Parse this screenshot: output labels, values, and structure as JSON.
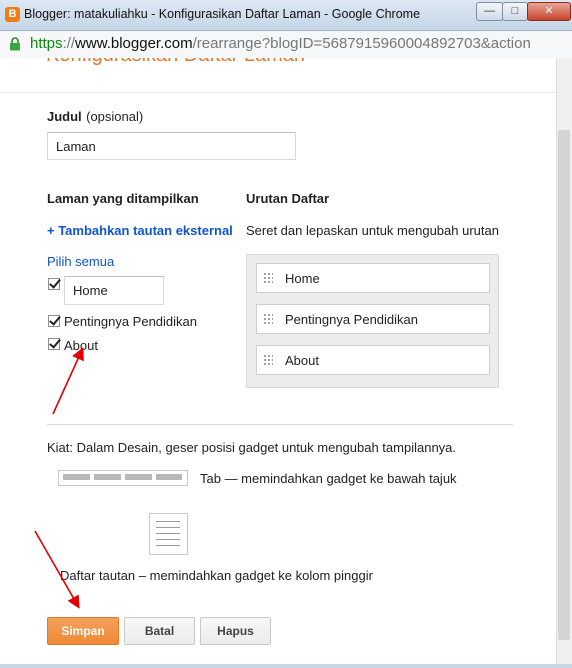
{
  "window": {
    "title": "Blogger: matakuliahku - Konfigurasikan Daftar Laman - Google Chrome",
    "favicon_letter": "B",
    "minimize": "—",
    "maximize": "□",
    "close": "✕"
  },
  "address": {
    "scheme": "https",
    "separator": "://",
    "host": "www.blogger.com",
    "path": "/rearrange?blogID=5687915960004892703&action"
  },
  "dialog": {
    "title": "Konfigurasikan Daftar Laman",
    "judul_label": "Judul",
    "judul_optional": "(opsional)",
    "judul_value": "Laman",
    "shown_heading": "Laman yang ditampilkan",
    "add_link": "+ Tambahkan tautan eksternal",
    "select_all": "Pilih semua",
    "pages": [
      {
        "label": "Home",
        "checked": true
      },
      {
        "label": "Pentingnya Pendidikan",
        "checked": true
      },
      {
        "label": "About",
        "checked": true
      }
    ],
    "order_heading": "Urutan Daftar",
    "order_hint": "Seret dan lepaskan untuk mengubah urutan",
    "order_items": [
      "Home",
      "Pentingnya Pendidikan",
      "About"
    ],
    "tip": "Kiat: Dalam Desain, geser posisi gadget untuk mengubah tampilannya.",
    "tab_tip": "Tab — memindahkan gadget ke bawah tajuk",
    "list_tip": "Daftar tautan – memindahkan gadget ke kolom pinggir",
    "buttons": {
      "save": "Simpan",
      "cancel": "Batal",
      "delete": "Hapus"
    }
  },
  "colors": {
    "accent": "#e3772e",
    "link": "#1155cc",
    "save_button": "#ef8a37",
    "annotation_arrow": "#e00000"
  }
}
